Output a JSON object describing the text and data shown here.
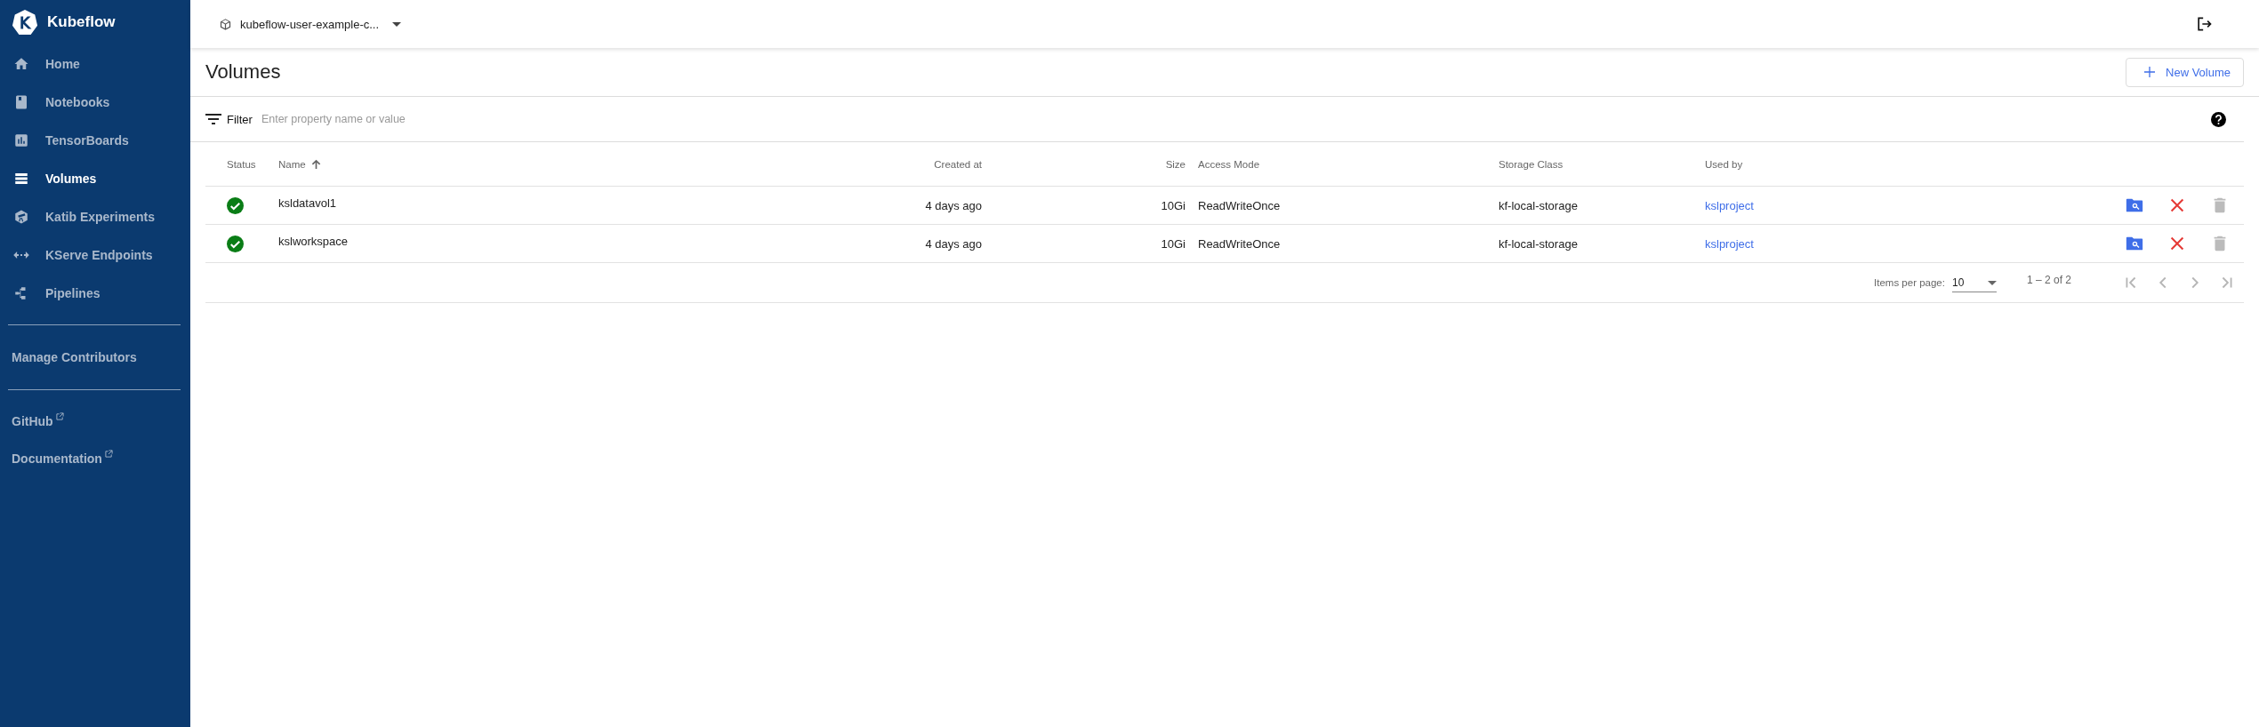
{
  "sidebar": {
    "brand": "Kubeflow",
    "items": [
      {
        "label": "Home",
        "selected": false
      },
      {
        "label": "Notebooks",
        "selected": false
      },
      {
        "label": "TensorBoards",
        "selected": false
      },
      {
        "label": "Volumes",
        "selected": true
      },
      {
        "label": "Katib Experiments",
        "selected": false
      },
      {
        "label": "KServe Endpoints",
        "selected": false
      },
      {
        "label": "Pipelines",
        "selected": false
      }
    ],
    "manage_link": "Manage Contributors",
    "external_links": [
      "GitHub",
      "Documentation"
    ]
  },
  "top_bar": {
    "namespace": "kubeflow-user-example-c..."
  },
  "page": {
    "title": "Volumes",
    "new_button": "New Volume"
  },
  "filter": {
    "label": "Filter",
    "placeholder": "Enter property name or value"
  },
  "table": {
    "columns": [
      {
        "label": "Status",
        "sorted": false
      },
      {
        "label": "Name",
        "sorted": true
      },
      {
        "label": "Created at",
        "sorted": false
      },
      {
        "label": "Size",
        "sorted": false
      },
      {
        "label": "Access Mode",
        "sorted": false
      },
      {
        "label": "Storage Class",
        "sorted": false
      },
      {
        "label": "Used by",
        "sorted": false
      }
    ],
    "rows": [
      {
        "ready": true,
        "name": "ksldatavol1",
        "created_at": "4 days ago",
        "size": "10Gi",
        "access_mode": "ReadWriteOnce",
        "storage_class": "kf-local-storage",
        "used_by": "kslproject",
        "actions": [
          {
            "kind": "browse",
            "disabled": false
          },
          {
            "kind": "close",
            "disabled": false
          },
          {
            "kind": "delete",
            "disabled": true
          }
        ]
      },
      {
        "ready": true,
        "name": "kslworkspace",
        "created_at": "4 days ago",
        "size": "10Gi",
        "access_mode": "ReadWriteOnce",
        "storage_class": "kf-local-storage",
        "used_by": "kslproject",
        "actions": [
          {
            "kind": "browse",
            "disabled": false
          },
          {
            "kind": "close",
            "disabled": false
          },
          {
            "kind": "delete",
            "disabled": true
          }
        ]
      }
    ]
  },
  "pagination": {
    "items_per_page_label": "Items per page:",
    "page_size": "10",
    "range": "1 – 2 of 2",
    "buttons": [
      {
        "kind": "first",
        "disabled": true
      },
      {
        "kind": "prev",
        "disabled": true
      },
      {
        "kind": "next",
        "disabled": true
      },
      {
        "kind": "last",
        "disabled": true
      }
    ]
  }
}
